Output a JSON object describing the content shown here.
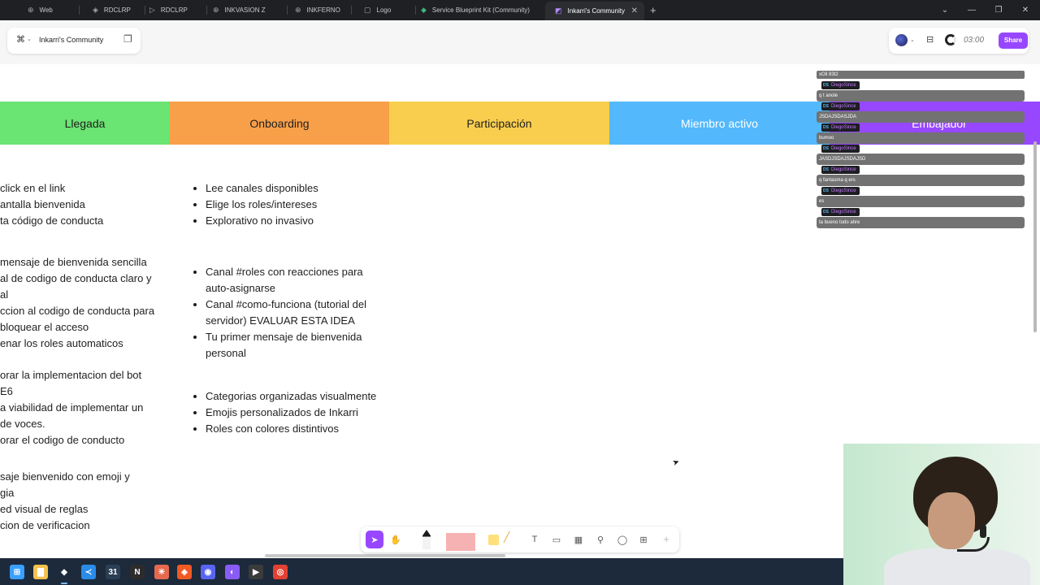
{
  "browser": {
    "tabs": [
      {
        "label": "Web",
        "icon": "globe-icon",
        "glyph": "⊕"
      },
      {
        "label": "RDCLRP",
        "icon": "figma-file-icon",
        "glyph": "◈"
      },
      {
        "label": "RDCLRP",
        "icon": "triangle-file-icon",
        "glyph": "▷"
      },
      {
        "label": "INKVASION Z",
        "icon": "globe-icon",
        "glyph": "⊕"
      },
      {
        "label": "INKFERNO",
        "icon": "globe-icon",
        "glyph": "⊕"
      },
      {
        "label": "Logo",
        "icon": "image-icon",
        "glyph": "▢"
      },
      {
        "label": "Service Blueprint Kit (Community)",
        "icon": "figma-file-icon",
        "glyph": "◆"
      },
      {
        "label": "Inkarri's Community",
        "icon": "figjam-file-icon",
        "glyph": "◩",
        "active": true
      }
    ],
    "new_tab": "+",
    "close_tab": "✕",
    "window_controls": {
      "chevron": "⌄",
      "minimize": "—",
      "restore": "❐",
      "close": "✕"
    }
  },
  "header": {
    "file_name": "Inkarri's Community",
    "timer": "03:00",
    "share_label": "Share"
  },
  "board": {
    "stages": [
      {
        "label": "Llegada",
        "color": "#6ae472"
      },
      {
        "label": "Onboarding",
        "color": "#f7a049"
      },
      {
        "label": "Participación",
        "color": "#f9ce4e"
      },
      {
        "label": "Miembro activo",
        "color": "#54b8fc",
        "text_color": "#ffffff"
      },
      {
        "label": "Embajador",
        "color": "#9747ff",
        "text_color": "#ffffff"
      }
    ],
    "llegada_lines": [
      "click en el link",
      "antalla bienvenida",
      "ta código de conducta",
      "mensaje de bienvenida sencilla",
      "al de codigo de conducta claro y",
      "al",
      "ccion al codigo de conducta para",
      "bloquear el acceso",
      "enar los roles automaticos",
      "orar la implementacion del bot",
      "E6",
      "a viabilidad de implementar un",
      "de voces.",
      "orar el codigo de conducto",
      "saje bienvenido con emoji y",
      "gia",
      "ed visual de reglas",
      "cion de verificacion"
    ],
    "onboarding_group1": [
      "Lee canales disponibles",
      "Elige los roles/intereses",
      "Explorativo no invasivo"
    ],
    "onboarding_group2": [
      "Canal #roles con reacciones para",
      "auto-asignarse",
      "Canal #como-funciona (tutorial del",
      "servidor) EVALUAR ESTA IDEA",
      "Tu primer mensaje de bienvenida",
      "personal"
    ],
    "onboarding_group3": [
      "Categorias organizadas visualmente",
      "Emojis personalizados de Inkarri",
      "Roles con colores distintivos"
    ]
  },
  "chat": {
    "top_line": "xOil 83t2",
    "messages": [
      {
        "user": "DiegoSince",
        "badge": "DS",
        "text": "q t anole"
      },
      {
        "user": "DiegoSince",
        "badge": "DS",
        "text": "JSDAJSDASJDA"
      },
      {
        "user": "DiegoSince",
        "badge": "DS",
        "text": "bumoo"
      },
      {
        "user": "DiegoSince",
        "badge": "DS",
        "text": "JASDJSDAJSDAJSD"
      },
      {
        "user": "DiegoSince",
        "badge": "DS",
        "text": "q fantasma q ers"
      },
      {
        "user": "DiegoSince",
        "badge": "DS",
        "text": "es"
      },
      {
        "user": "DiegoSince",
        "badge": "DS",
        "text": "ta bueno todo ahre"
      }
    ]
  },
  "toolbar": {
    "tools": [
      {
        "name": "select-tool",
        "glyph": "➤"
      },
      {
        "name": "hand-tool",
        "glyph": "✋"
      },
      {
        "name": "text-tool",
        "glyph": "T"
      },
      {
        "name": "section-tool",
        "glyph": "▭"
      },
      {
        "name": "table-tool",
        "glyph": "▦"
      },
      {
        "name": "stamp-tool",
        "glyph": "⚲"
      },
      {
        "name": "comment-tool",
        "glyph": "◯"
      },
      {
        "name": "widgets-tool",
        "glyph": "⊞"
      }
    ],
    "more": "+"
  },
  "taskbar": {
    "apps": [
      {
        "name": "windows-start-icon",
        "glyph": "⊞",
        "color": "#3aa0ff"
      },
      {
        "name": "file-explorer-icon",
        "glyph": "▇",
        "color": "#f5c14b"
      },
      {
        "name": "figma-app-icon",
        "glyph": "◆",
        "color": "#1c2a3c"
      },
      {
        "name": "vscode-icon",
        "glyph": "≺",
        "color": "#2b8ce8"
      },
      {
        "name": "calendar-app-icon",
        "glyph": "31",
        "color": "#2c3e54"
      },
      {
        "name": "notion-icon",
        "glyph": "N",
        "color": "#2c2c2c"
      },
      {
        "name": "spark-app-icon",
        "glyph": "✳",
        "color": "#e4694f"
      },
      {
        "name": "brave-icon",
        "glyph": "◈",
        "color": "#f15a24"
      },
      {
        "name": "discord-icon",
        "glyph": "◉",
        "color": "#5865f2"
      },
      {
        "name": "obs-icon",
        "glyph": "◐",
        "color": "#8a5cf6"
      },
      {
        "name": "capture-app-icon",
        "glyph": "▶",
        "color": "#3b3b3b"
      },
      {
        "name": "chrome-icon",
        "glyph": "◎",
        "color": "#e34133"
      }
    ]
  }
}
